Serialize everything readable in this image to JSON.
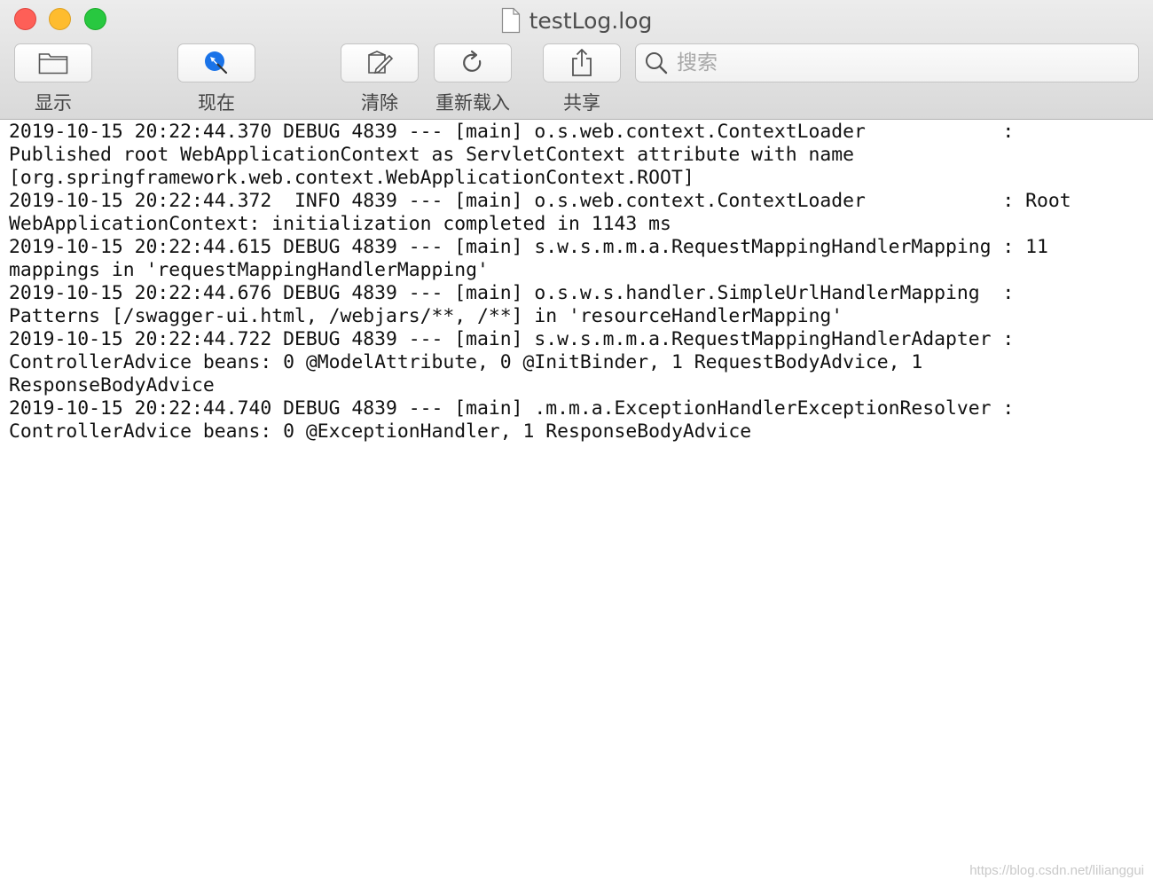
{
  "window": {
    "title": "testLog.log"
  },
  "toolbar": {
    "show_label": "显示",
    "now_label": "现在",
    "clear_label": "清除",
    "reload_label": "重新载入",
    "share_label": "共享"
  },
  "search": {
    "placeholder": "搜索",
    "value": ""
  },
  "log": {
    "lines": [
      "2019-10-15 20:22:44.370 DEBUG 4839 --- [main] o.s.web.context.ContextLoader            :",
      "Published root WebApplicationContext as ServletContext attribute with name",
      "[org.springframework.web.context.WebApplicationContext.ROOT]",
      "2019-10-15 20:22:44.372  INFO 4839 --- [main] o.s.web.context.ContextLoader            : Root",
      "WebApplicationContext: initialization completed in 1143 ms",
      "2019-10-15 20:22:44.615 DEBUG 4839 --- [main] s.w.s.m.m.a.RequestMappingHandlerMapping : 11",
      "mappings in 'requestMappingHandlerMapping'",
      "2019-10-15 20:22:44.676 DEBUG 4839 --- [main] o.s.w.s.handler.SimpleUrlHandlerMapping  :",
      "Patterns [/swagger-ui.html, /webjars/**, /**] in 'resourceHandlerMapping'",
      "2019-10-15 20:22:44.722 DEBUG 4839 --- [main] s.w.s.m.m.a.RequestMappingHandlerAdapter :",
      "ControllerAdvice beans: 0 @ModelAttribute, 0 @InitBinder, 1 RequestBodyAdvice, 1",
      "ResponseBodyAdvice",
      "2019-10-15 20:22:44.740 DEBUG 4839 --- [main] .m.m.a.ExceptionHandlerExceptionResolver :",
      "ControllerAdvice beans: 0 @ExceptionHandler, 1 ResponseBodyAdvice"
    ]
  },
  "watermark": "https://blog.csdn.net/lilianggui",
  "colors": {
    "close": "#fe5f57",
    "minimize": "#febc2e",
    "maximize": "#28c840",
    "accent": "#1a73e8"
  },
  "icons": {
    "show": "folder-icon",
    "now": "cursor-arrow-icon",
    "clear": "clear-icon",
    "reload": "reload-icon",
    "share": "share-icon",
    "search": "search-icon",
    "title": "document-icon"
  }
}
